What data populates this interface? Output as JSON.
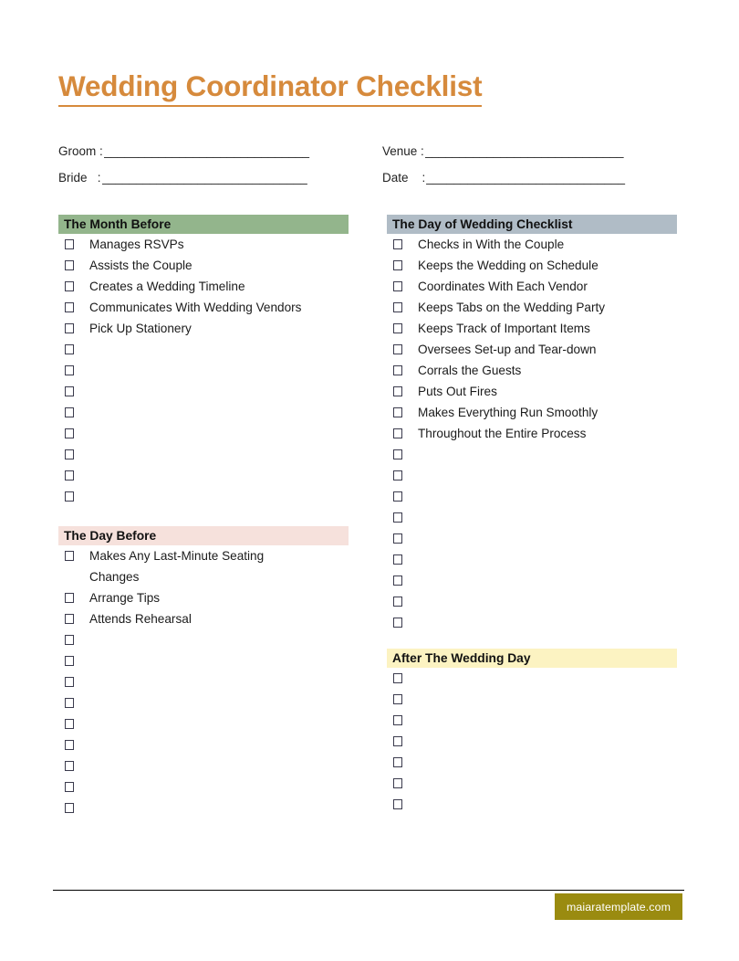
{
  "document": {
    "title": "Wedding Coordinator Checklist",
    "title_color": "#D68A3C"
  },
  "form": {
    "rows": [
      {
        "left": {
          "label": "Groom ",
          "colon": ":",
          "line": "______________________________"
        },
        "right": {
          "label": "Venue ",
          "colon": ":",
          "line": "_____________________________"
        }
      },
      {
        "left": {
          "label": "Bride   ",
          "colon": ":",
          "line": "______________________________"
        },
        "right": {
          "label": "Date    ",
          "colon": ":",
          "line": "_____________________________"
        }
      }
    ]
  },
  "columns": {
    "left": [
      {
        "heading": "The Month Before",
        "heading_bg": "#93B58C",
        "items": [
          {
            "label": "Manages RSVPs"
          },
          {
            "label": "Assists the Couple"
          },
          {
            "label": "Creates a Wedding Timeline"
          },
          {
            "label": "Communicates With Wedding Vendors"
          },
          {
            "label": "Pick Up Stationery"
          },
          {
            "label": ""
          },
          {
            "label": ""
          },
          {
            "label": ""
          },
          {
            "label": ""
          },
          {
            "label": ""
          },
          {
            "label": ""
          },
          {
            "label": ""
          },
          {
            "label": ""
          }
        ]
      },
      {
        "heading": "The Day Before",
        "heading_bg": "#F6E1DC",
        "items": [
          {
            "label": "Makes Any Last-Minute Seating",
            "continuation": "Changes"
          },
          {
            "label": "Arrange Tips"
          },
          {
            "label": "Attends Rehearsal"
          },
          {
            "label": ""
          },
          {
            "label": ""
          },
          {
            "label": ""
          },
          {
            "label": ""
          },
          {
            "label": ""
          },
          {
            "label": ""
          },
          {
            "label": ""
          },
          {
            "label": ""
          },
          {
            "label": ""
          }
        ]
      }
    ],
    "right": [
      {
        "heading": "The Day of Wedding Checklist",
        "heading_bg": "#B0BCC6",
        "items": [
          {
            "label": "Checks in With the Couple"
          },
          {
            "label": "Keeps the Wedding on Schedule"
          },
          {
            "label": "Coordinates With Each Vendor"
          },
          {
            "label": "Keeps Tabs on the Wedding Party"
          },
          {
            "label": "Keeps Track of Important Items"
          },
          {
            "label": "Oversees Set-up and Tear-down"
          },
          {
            "label": "Corrals the Guests"
          },
          {
            "label": "Puts Out Fires"
          },
          {
            "label": "Makes Everything Run Smoothly"
          },
          {
            "label": "Throughout the Entire Process"
          },
          {
            "label": ""
          },
          {
            "label": ""
          },
          {
            "label": ""
          },
          {
            "label": ""
          },
          {
            "label": ""
          },
          {
            "label": ""
          },
          {
            "label": ""
          },
          {
            "label": ""
          },
          {
            "label": ""
          }
        ]
      },
      {
        "heading": "After The Wedding Day",
        "heading_bg": "#FCF3C2",
        "items": [
          {
            "label": ""
          },
          {
            "label": ""
          },
          {
            "label": ""
          },
          {
            "label": ""
          },
          {
            "label": ""
          },
          {
            "label": ""
          },
          {
            "label": ""
          }
        ]
      }
    ]
  },
  "footer": {
    "brand": "maiaratemplate.com",
    "brand_bg": "#9A8B10"
  }
}
